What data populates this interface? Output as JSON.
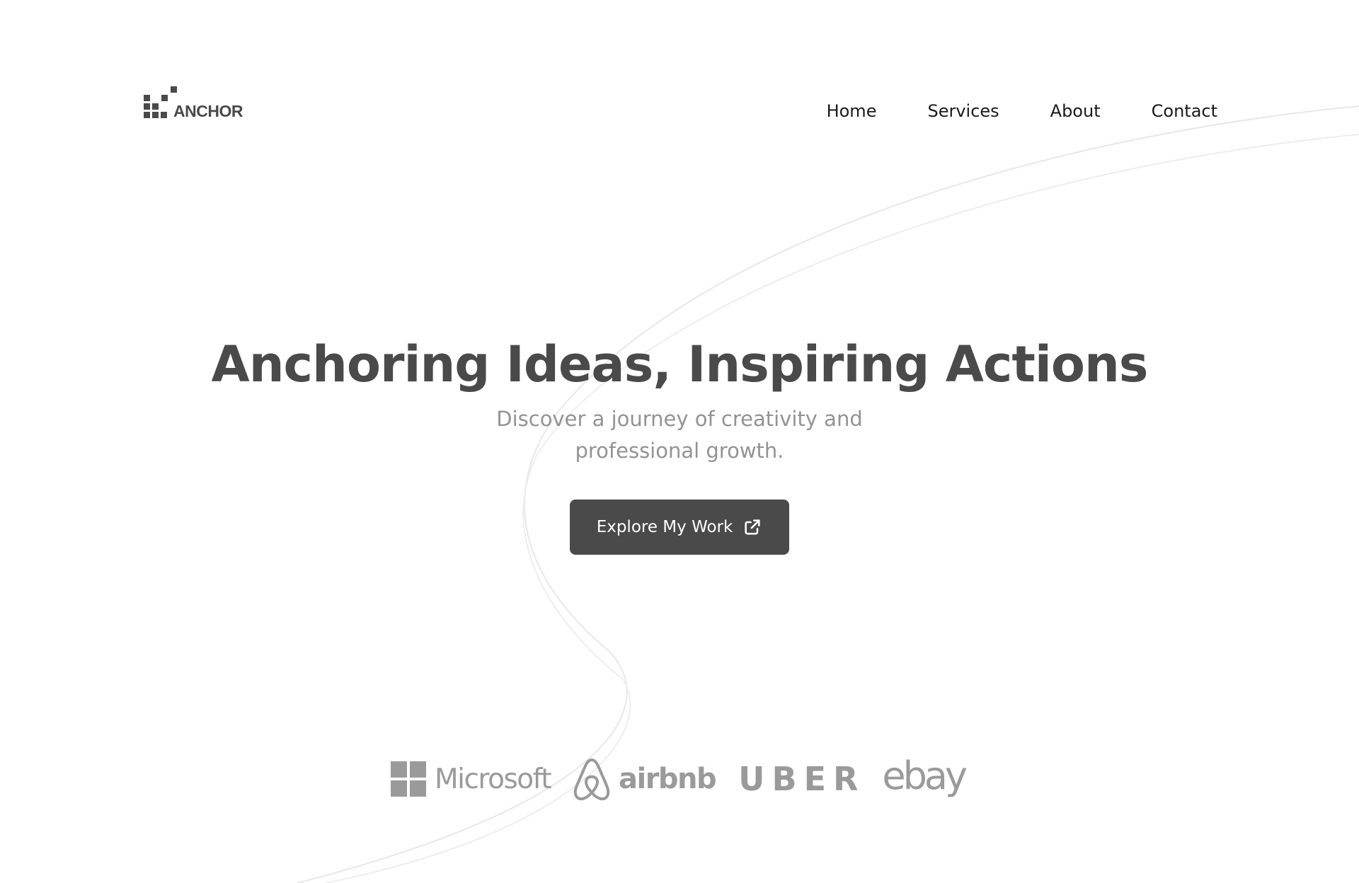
{
  "brand": {
    "name": "ANCHOR"
  },
  "nav": {
    "items": [
      {
        "label": "Home"
      },
      {
        "label": "Services"
      },
      {
        "label": "About"
      },
      {
        "label": "Contact"
      }
    ]
  },
  "hero": {
    "title": "Anchoring Ideas, Inspiring Actions",
    "subtitle": "Discover a journey of creativity and professional growth.",
    "cta_label": "Explore My Work",
    "cta_icon": "external-link-icon"
  },
  "client_logos": [
    {
      "name": "Microsoft",
      "icon": "microsoft-windows-icon"
    },
    {
      "name": "airbnb",
      "icon": "airbnb-belo-icon"
    },
    {
      "name": "UBER"
    },
    {
      "name": "ebay"
    }
  ],
  "colors": {
    "primary": "#4a4a4a",
    "muted_text": "#939393",
    "logo_gray": "#9a9a9a",
    "background": "#ffffff"
  }
}
